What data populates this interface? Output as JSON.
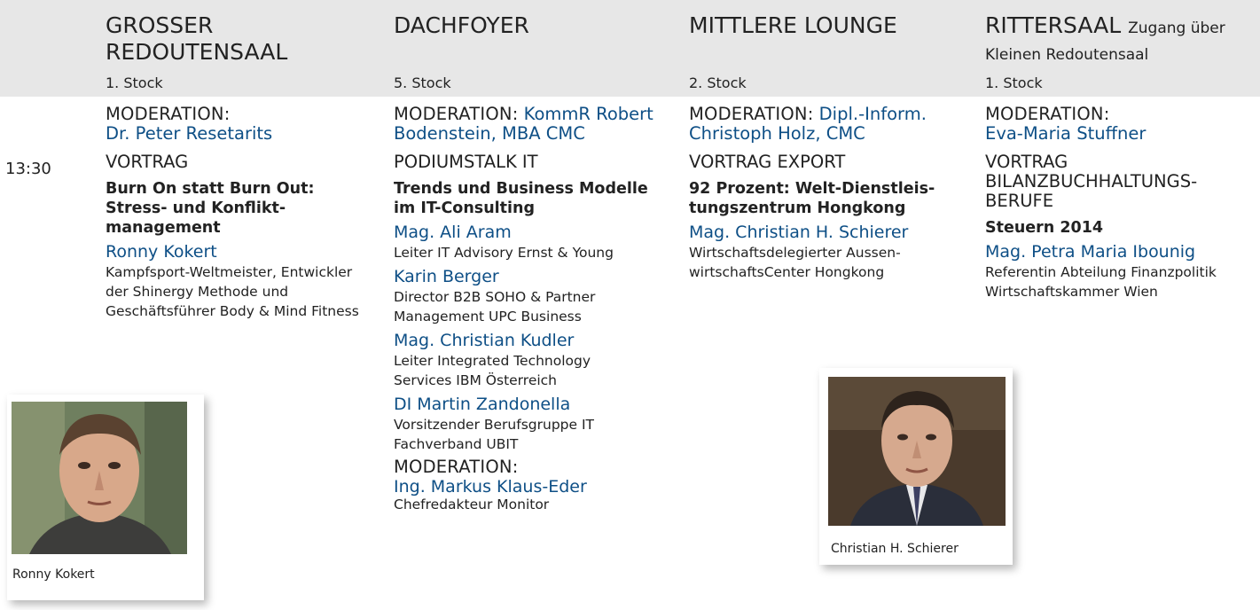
{
  "time": "13:30",
  "columns": [
    {
      "room": "GROSSER REDOUTENSAAL",
      "room_sub": "",
      "floor": "1. Stock",
      "moderation_label": "MODERATION:",
      "moderation_name": "Dr. Peter Resetarits",
      "kind": "VORTRAG",
      "title": "Burn On statt Burn Out: Stress- und Konflikt­management",
      "speakers": [
        {
          "name": "Ronny Kokert",
          "desc": "Kampfsport-Weltmeister, Entwickler der Shinergy Methode und Geschäftsführer Body & Mind Fitness"
        }
      ]
    },
    {
      "room": "DACHFOYER",
      "room_sub": "",
      "floor": "5. Stock",
      "moderation_label": "MODERATION:",
      "moderation_name": "KommR Robert Bodenstein, MBA CMC",
      "kind": "PODIUMSTALK IT",
      "title": "Trends und Business Modelle im IT-Consulting",
      "speakers": [
        {
          "name": "Mag. Ali Aram",
          "desc": "Leiter IT Advisory Ernst & Young"
        },
        {
          "name": "Karin Berger",
          "desc": "Director B2B SOHO & Partner Management UPC Business"
        },
        {
          "name": "Mag. Christian Kudler",
          "desc": "Leiter Integrated Technology Services IBM Österreich"
        },
        {
          "name": "DI Martin Zandonella",
          "desc": "Vorsitzender Berufsgruppe IT Fachverband UBIT"
        }
      ],
      "moderation2_label": "MODERATION:",
      "moderation2_name": "Ing. Markus Klaus-Eder",
      "moderation2_desc": "Chefredakteur Monitor"
    },
    {
      "room": "MITTLERE LOUNGE",
      "room_sub": "",
      "floor": "2. Stock",
      "moderation_label": "MODERATION:",
      "moderation_name": "Dipl.-Inform. Christoph Holz, CMC",
      "kind": "VORTRAG EXPORT",
      "title": "92 Prozent: Welt-Dienstleis­tungszentrum Hongkong",
      "speakers": [
        {
          "name": "Mag. Christian H. Schierer",
          "desc": "Wirtschaftsdelegierter Aussen­wirtschaftsCenter Hongkong"
        }
      ]
    },
    {
      "room": "RITTERSAAL",
      "room_sub": "Zugang über Kleinen Redoutensaal",
      "floor": "1. Stock",
      "moderation_label": "MODERATION:",
      "moderation_name": "Eva-Maria Stuffner",
      "kind": "VORTRAG BILANZBUCHHALTUNGS­BERUFE",
      "title": "Steuern 2014",
      "speakers": [
        {
          "name": "Mag. Petra Maria Ibounig",
          "desc": "Referentin Abteilung Finanz­politik Wirtschaftskammer Wien"
        }
      ]
    }
  ],
  "photos": [
    {
      "caption": "Ronny Kokert"
    },
    {
      "caption": "Christian H. Schierer"
    }
  ]
}
